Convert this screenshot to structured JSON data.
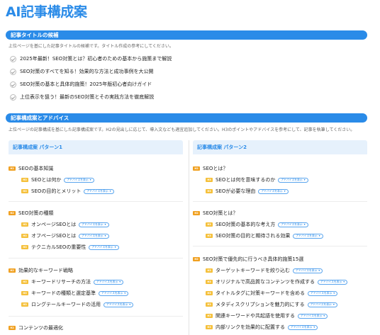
{
  "page_title": "AI記事構成案",
  "titles_section": {
    "heading": "記事タイトルの候補",
    "description": "上位ページを基にした記事タイトルの候補です。タイトル作成の参考にしてください。",
    "items": [
      "2025年最新！SEO対策とは？初心者のための基本から施策まで解説",
      "SEO対策のすべてを知る！効果的な方法と成功事例を大公開",
      "SEO対策の基本と具体的施策！2025年版初心者向けガイド",
      "上位表示を狙う！最新のSEO対策とその実践方法を徹底解説"
    ]
  },
  "structure_section": {
    "heading": "記事構成案とアドバイス",
    "description": "上位ページの記事構成を基にした記事構成案です。H2の見出しに応じて、導入文なども適宜追加してください。H3のポイントやアドバイスを参考にして、記事を執筆してください。"
  },
  "tags": {
    "h2": "H2",
    "h3": "H3"
  },
  "advice_label": "アドバイスを表示",
  "patterns": [
    {
      "title": "記事構成案 パターン1",
      "groups": [
        {
          "h2": "SEOの基本知識",
          "h3": [
            "SEOとは何か",
            "SEOの目的とメリット"
          ]
        },
        {
          "h2": "SEO対策の種類",
          "h3": [
            "オンページSEOとは",
            "オフページSEOとは",
            "テクニカルSEOの重要性"
          ]
        },
        {
          "h2": "効果的なキーワード戦略",
          "h3": [
            "キーワードリサーチの方法",
            "キーワードの種類と選定基準",
            "ロングテールキーワードの活用"
          ]
        },
        {
          "h2": "コンテンツの最適化",
          "h3": []
        }
      ]
    },
    {
      "title": "記事構成案 パターン2",
      "groups": [
        {
          "h2": "SEOとは？",
          "h3": [
            "SEOとは何を意味するのか",
            "SEOが必要な理由"
          ]
        },
        {
          "h2": "SEO対策とは？",
          "h3": [
            "SEO対策の基本的な考え方",
            "SEO対策の目的と期待される効果"
          ]
        },
        {
          "h2": "SEO対策で優先的に行うべき具体的施策15選",
          "h3": [
            "ターゲットキーワードを絞り込む",
            "オリジナルで高品質なコンテンツを作成する",
            "タイトルタグに対策キーワードを含める",
            "メタディスクリプションを魅力的にする",
            "関連キーワードや共起語を使用する",
            "内部リンクを効果的に配置する"
          ]
        }
      ]
    }
  ]
}
